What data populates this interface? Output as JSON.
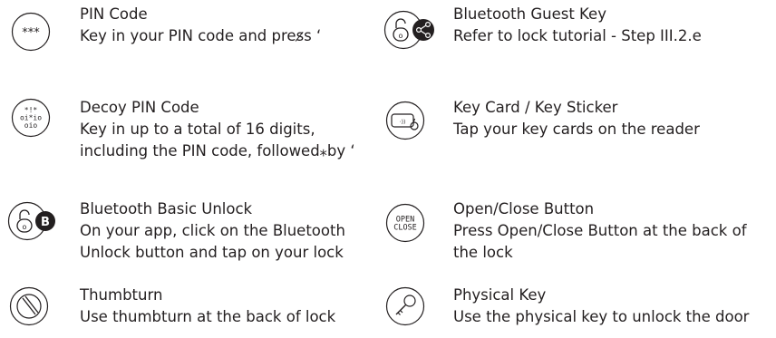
{
  "colors": {
    "ink": "#231f20",
    "background": "#ffffff"
  },
  "items": [
    {
      "icon": "asterisk-pin-icon",
      "title": "PIN Code",
      "desc": [
        "Key in your PIN code and pres̷s ‘"
      ]
    },
    {
      "icon": "decoy-pin-icon",
      "icon_glyphs": [
        "*!*",
        "oi*io",
        "oio"
      ],
      "title": "Decoy PIN Code",
      "desc": [
        "Key in up to a total of 16 digits,",
        "including the PIN code, followed⁎by ‘"
      ]
    },
    {
      "icon": "bluetooth-unlock-icon",
      "icon_badge": "B",
      "title": "Bluetooth Basic Unlock",
      "desc": [
        "On your app, click on the Bluetooth",
        "Unlock button and tap on your lock"
      ]
    },
    {
      "icon": "thumbturn-icon",
      "title": "Thumbturn",
      "desc": [
        "Use thumbturn at the back of lock"
      ]
    },
    {
      "icon": "bluetooth-guest-key-icon",
      "title": "Bluetooth Guest Key",
      "desc": [
        "Refer to lock tutorial - Step III.2.e"
      ]
    },
    {
      "icon": "key-card-icon",
      "title": "Key Card / Key Sticker",
      "desc": [
        "Tap your key cards on the reader"
      ]
    },
    {
      "icon": "open-close-button-icon",
      "icon_text": [
        "OPEN",
        "CLOSE"
      ],
      "title": "Open/Close Button",
      "desc": [
        "Press Open/Close Button at the back of",
        "the lock"
      ]
    },
    {
      "icon": "physical-key-icon",
      "title": "Physical Key",
      "desc": [
        "Use the physical key to unlock the door"
      ]
    }
  ]
}
